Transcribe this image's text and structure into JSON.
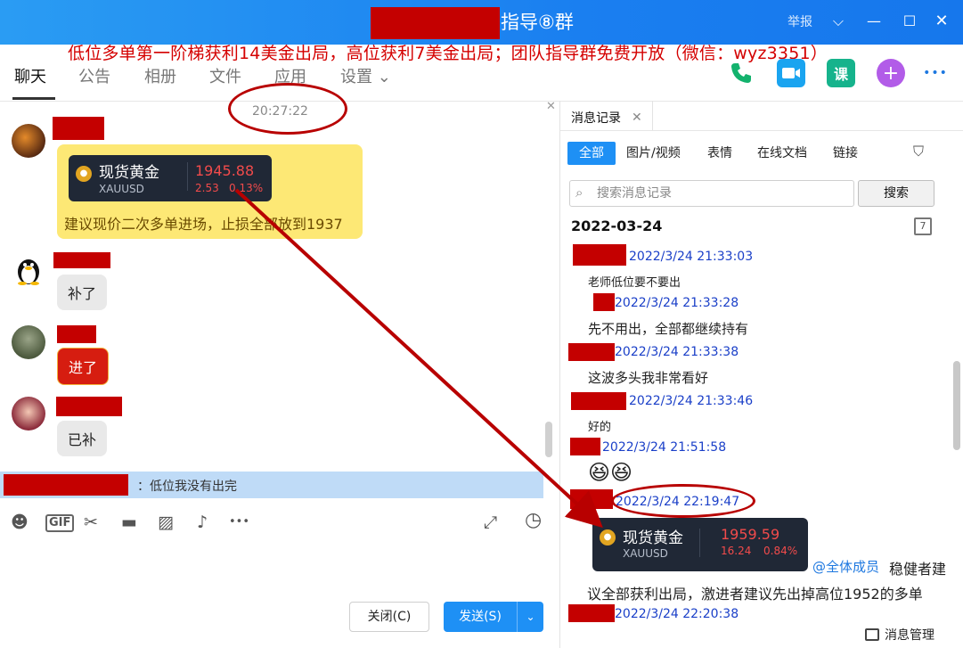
{
  "window": {
    "title": "指导⑧群",
    "report_label": "举报",
    "chevron_glyph": "⌵",
    "minimize_glyph": "—",
    "maximize_glyph": "☐",
    "close_glyph": "✕"
  },
  "banner": "低位多单第一阶梯获利14美金出局，高位获利7美金出局；团队指导群免费开放（微信：wyz3351）",
  "tabs": [
    "聊天",
    "公告",
    "相册",
    "文件",
    "应用",
    "设置 ⌄"
  ],
  "top_icons": [
    "phone-icon",
    "video-icon",
    "course-icon",
    "plus-icon",
    "more-icon"
  ],
  "top_icon_labels": {
    "course": "课",
    "plus": "+",
    "more": "•••"
  },
  "chat": {
    "time": "20:27:22",
    "pin_close": "✕",
    "gold_card": {
      "name": "现货黄金",
      "symbol": "XAUUSD",
      "price": "1945.88",
      "change": "2.53",
      "change_pct": "0.13%"
    },
    "gold_note": "建议现价二次多单进场，止损全部放到1937",
    "messages": [
      {
        "text": "补了"
      },
      {
        "text": "进了"
      },
      {
        "text": "已补"
      }
    ],
    "quote": "：低位我没有出完"
  },
  "toolbar": {
    "emoji": "☻",
    "gif": "GIF",
    "scissors": "✂",
    "folder": "▬",
    "image": "▨",
    "bell": "♪",
    "more": "•••",
    "expand": "⤢",
    "history": "◷",
    "close_label": "关闭(C)",
    "send_label": "发送(S)",
    "send_arrow": "⌄"
  },
  "history": {
    "tab_label": "消息记录",
    "tab_close": "✕",
    "filters": [
      "全部",
      "图片/视频",
      "表情",
      "在线文档",
      "链接"
    ],
    "filter_icon": "⛉",
    "search_icon": "⌕",
    "search_placeholder": "搜索消息记录",
    "search_button": "搜索",
    "date": "2022-03-24",
    "calendar_day": "7",
    "records": [
      {
        "time": "2022/3/24 21:33:03",
        "text": "老师低位要不要出"
      },
      {
        "time": "2022/3/24 21:33:28",
        "text": "先不用出，全部都继续持有"
      },
      {
        "time": "2022/3/24 21:33:38",
        "text": "这波多头我非常看好"
      },
      {
        "time": "2022/3/24 21:33:46",
        "text": "好的"
      },
      {
        "time": "2022/3/24 21:51:58",
        "text": "😆😆"
      },
      {
        "time": "2022/3/24 22:19:47",
        "text": ""
      },
      {
        "time": "2022/3/24 22:20:38",
        "text": ""
      }
    ],
    "gold_card": {
      "name": "现货黄金",
      "symbol": "XAUUSD",
      "price": "1959.59",
      "change": "16.24",
      "change_pct": "0.84%"
    },
    "mention": "@全体成员",
    "mention_text": "稳健者建",
    "mention_text_2": "议全部获利出局，激进者建议先出掉高位1952的多单",
    "manage_label": "消息管理"
  },
  "colors": {
    "title_bar": "#1a7ff0",
    "annotation_red": "#b80000",
    "banner_red": "#d40000",
    "accent_blue": "#1e90f5",
    "highlight_yellow": "#fde875",
    "card_bg": "#202836",
    "price_red": "#f24b4b"
  }
}
